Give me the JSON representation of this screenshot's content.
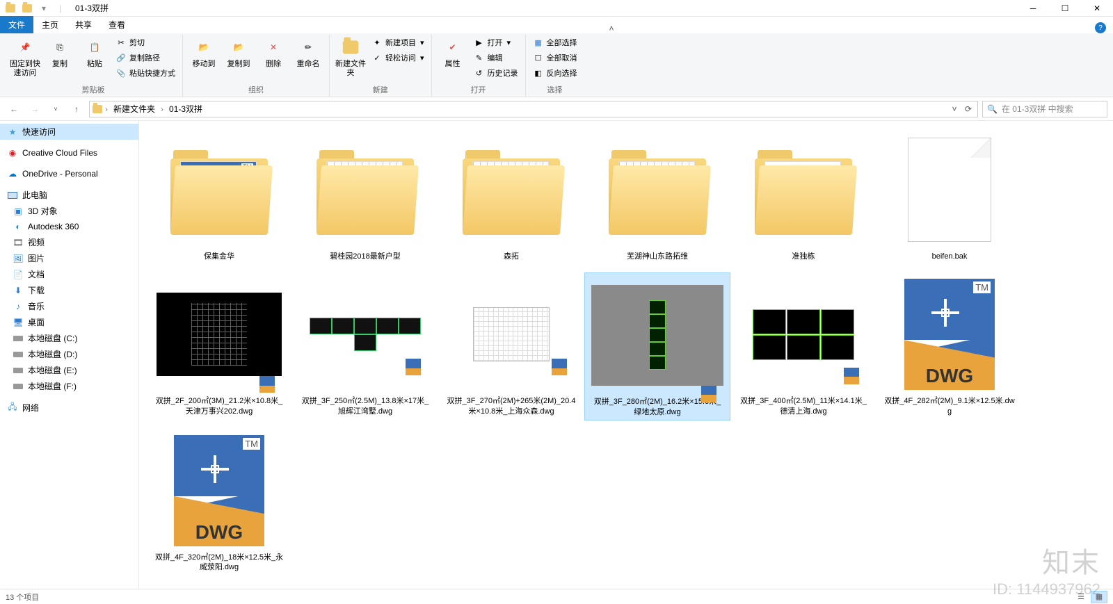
{
  "titlebar": {
    "title": "01-3双拼"
  },
  "tabs": {
    "file": "文件",
    "home": "主页",
    "share": "共享",
    "view": "查看"
  },
  "ribbon": {
    "clipboard": {
      "label": "剪贴板",
      "pin": "固定到快速访问",
      "copy": "复制",
      "paste": "粘贴",
      "cut": "剪切",
      "copy_path": "复制路径",
      "paste_shortcut": "粘贴快捷方式"
    },
    "organize": {
      "label": "组织",
      "move_to": "移动到",
      "copy_to": "复制到",
      "delete": "删除",
      "rename": "重命名"
    },
    "new": {
      "label": "新建",
      "new_folder": "新建文件夹",
      "new_item": "新建项目",
      "easy_access": "轻松访问"
    },
    "open": {
      "label": "打开",
      "properties": "属性",
      "open": "打开",
      "edit": "编辑",
      "history": "历史记录"
    },
    "select": {
      "label": "选择",
      "select_all": "全部选择",
      "select_none": "全部取消",
      "invert": "反向选择"
    }
  },
  "breadcrumb": {
    "seg1": "新建文件夹",
    "seg2": "01-3双拼"
  },
  "search": {
    "placeholder": "在 01-3双拼 中搜索"
  },
  "sidebar": {
    "quick": "快速访问",
    "ccf": "Creative Cloud Files",
    "onedrive": "OneDrive - Personal",
    "this_pc": "此电脑",
    "objects3d": "3D 对象",
    "autodesk360": "Autodesk 360",
    "videos": "视频",
    "pictures": "图片",
    "documents": "文档",
    "downloads": "下载",
    "music": "音乐",
    "desktop": "桌面",
    "drive_c": "本地磁盘 (C:)",
    "drive_d": "本地磁盘 (D:)",
    "drive_e": "本地磁盘 (E:)",
    "drive_f": "本地磁盘 (F:)",
    "network": "网络"
  },
  "items": [
    {
      "name": "保集金华",
      "type": "folder-dwg"
    },
    {
      "name": "碧桂园2018最新户型",
      "type": "folder-plan"
    },
    {
      "name": "森拓",
      "type": "folder-plan2"
    },
    {
      "name": "芜湖神山东路拓维",
      "type": "folder-plan2"
    },
    {
      "name": "准独栋",
      "type": "folder-elev"
    },
    {
      "name": "beifen.bak",
      "type": "blank"
    },
    {
      "name": "双拼_2F_200㎡(3M)_21.2米×10.8米_天津万事兴202.dwg",
      "type": "cad-dark"
    },
    {
      "name": "双拼_3F_250㎡(2.5M)_13.8米×17米_旭辉江湾墅.dwg",
      "type": "cad-blocks"
    },
    {
      "name": "双拼_3F_270㎡(2M)+265米(2M)_20.4米×10.8米_上海众森.dwg",
      "type": "cad-plansmall"
    },
    {
      "name": "双拼_3F_280㎡(2M)_16.2米×15.6米_绿地太原.dwg",
      "type": "cad-gray",
      "selected": true
    },
    {
      "name": "双拼_3F_400㎡(2.5M)_11米×14.1米_德清上海.dwg",
      "type": "cad-green"
    },
    {
      "name": "双拼_4F_282㎡(2M)_9.1米×12.5米.dwg",
      "type": "dwg"
    },
    {
      "name": "双拼_4F_320㎡(2M)_18米×12.5米_永威荥阳.dwg",
      "type": "dwg"
    }
  ],
  "dwg_ext": "DWG",
  "dwg_tm": "TM",
  "status": {
    "text": "13 个项目"
  },
  "watermark": {
    "brand": "知末",
    "id": "ID: 1144937962"
  }
}
